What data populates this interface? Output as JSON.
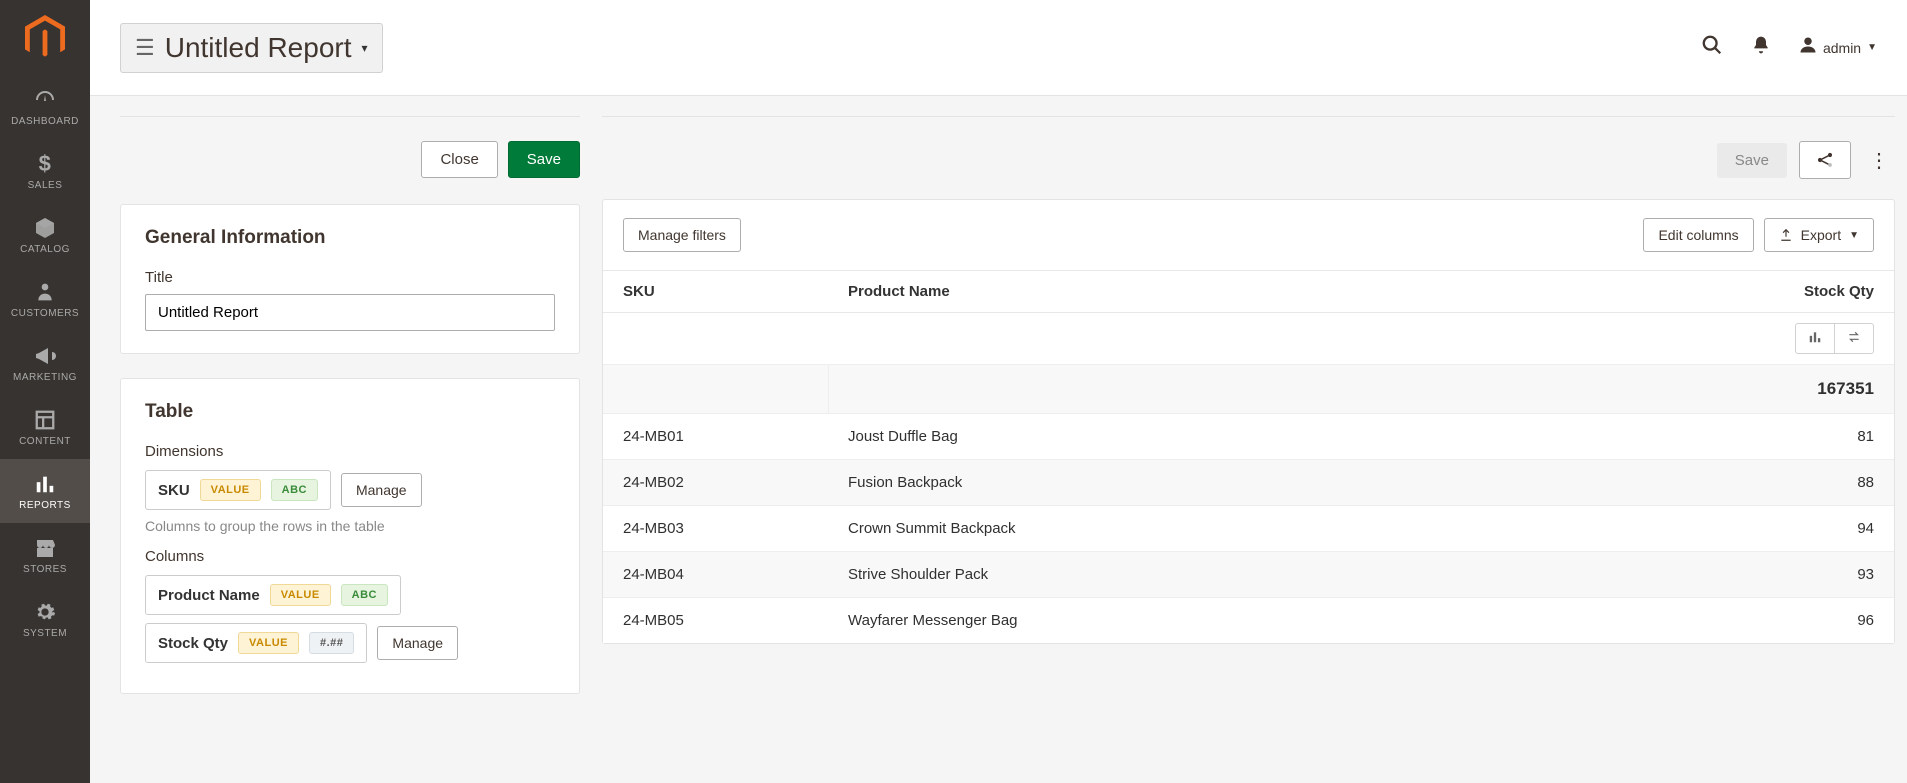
{
  "sidebar": {
    "items": [
      {
        "label": "DASHBOARD",
        "icon": "dashboard"
      },
      {
        "label": "SALES",
        "icon": "dollar"
      },
      {
        "label": "CATALOG",
        "icon": "catalog"
      },
      {
        "label": "CUSTOMERS",
        "icon": "person"
      },
      {
        "label": "MARKETING",
        "icon": "megaphone"
      },
      {
        "label": "CONTENT",
        "icon": "content"
      },
      {
        "label": "REPORTS",
        "icon": "reports"
      },
      {
        "label": "STORES",
        "icon": "stores"
      },
      {
        "label": "SYSTEM",
        "icon": "system"
      }
    ],
    "active_index": 6
  },
  "header": {
    "title": "Untitled Report",
    "user": "admin"
  },
  "left": {
    "close": "Close",
    "save": "Save",
    "general_heading": "General Information",
    "title_label": "Title",
    "title_value": "Untitled Report",
    "table_heading": "Table",
    "dimensions_label": "Dimensions",
    "dimensions_hint": "Columns to group the rows in the table",
    "columns_label": "Columns",
    "manage": "Manage",
    "dim": {
      "name": "SKU",
      "tag1": "VALUE",
      "tag2": "ABC"
    },
    "cols": [
      {
        "name": "Product Name",
        "tag1": "VALUE",
        "tag2": "ABC"
      },
      {
        "name": "Stock Qty",
        "tag1": "VALUE",
        "tag2": "#.##"
      }
    ]
  },
  "right": {
    "save": "Save",
    "manage_filters": "Manage filters",
    "edit_columns": "Edit columns",
    "export": "Export",
    "columns": [
      "SKU",
      "Product Name",
      "Stock Qty"
    ],
    "total_qty": "167351",
    "rows": [
      {
        "sku": "24-MB01",
        "name": "Joust Duffle Bag",
        "qty": "81"
      },
      {
        "sku": "24-MB02",
        "name": "Fusion Backpack",
        "qty": "88"
      },
      {
        "sku": "24-MB03",
        "name": "Crown Summit Backpack",
        "qty": "94"
      },
      {
        "sku": "24-MB04",
        "name": "Strive Shoulder Pack",
        "qty": "93"
      },
      {
        "sku": "24-MB05",
        "name": "Wayfarer Messenger Bag",
        "qty": "96"
      }
    ]
  }
}
